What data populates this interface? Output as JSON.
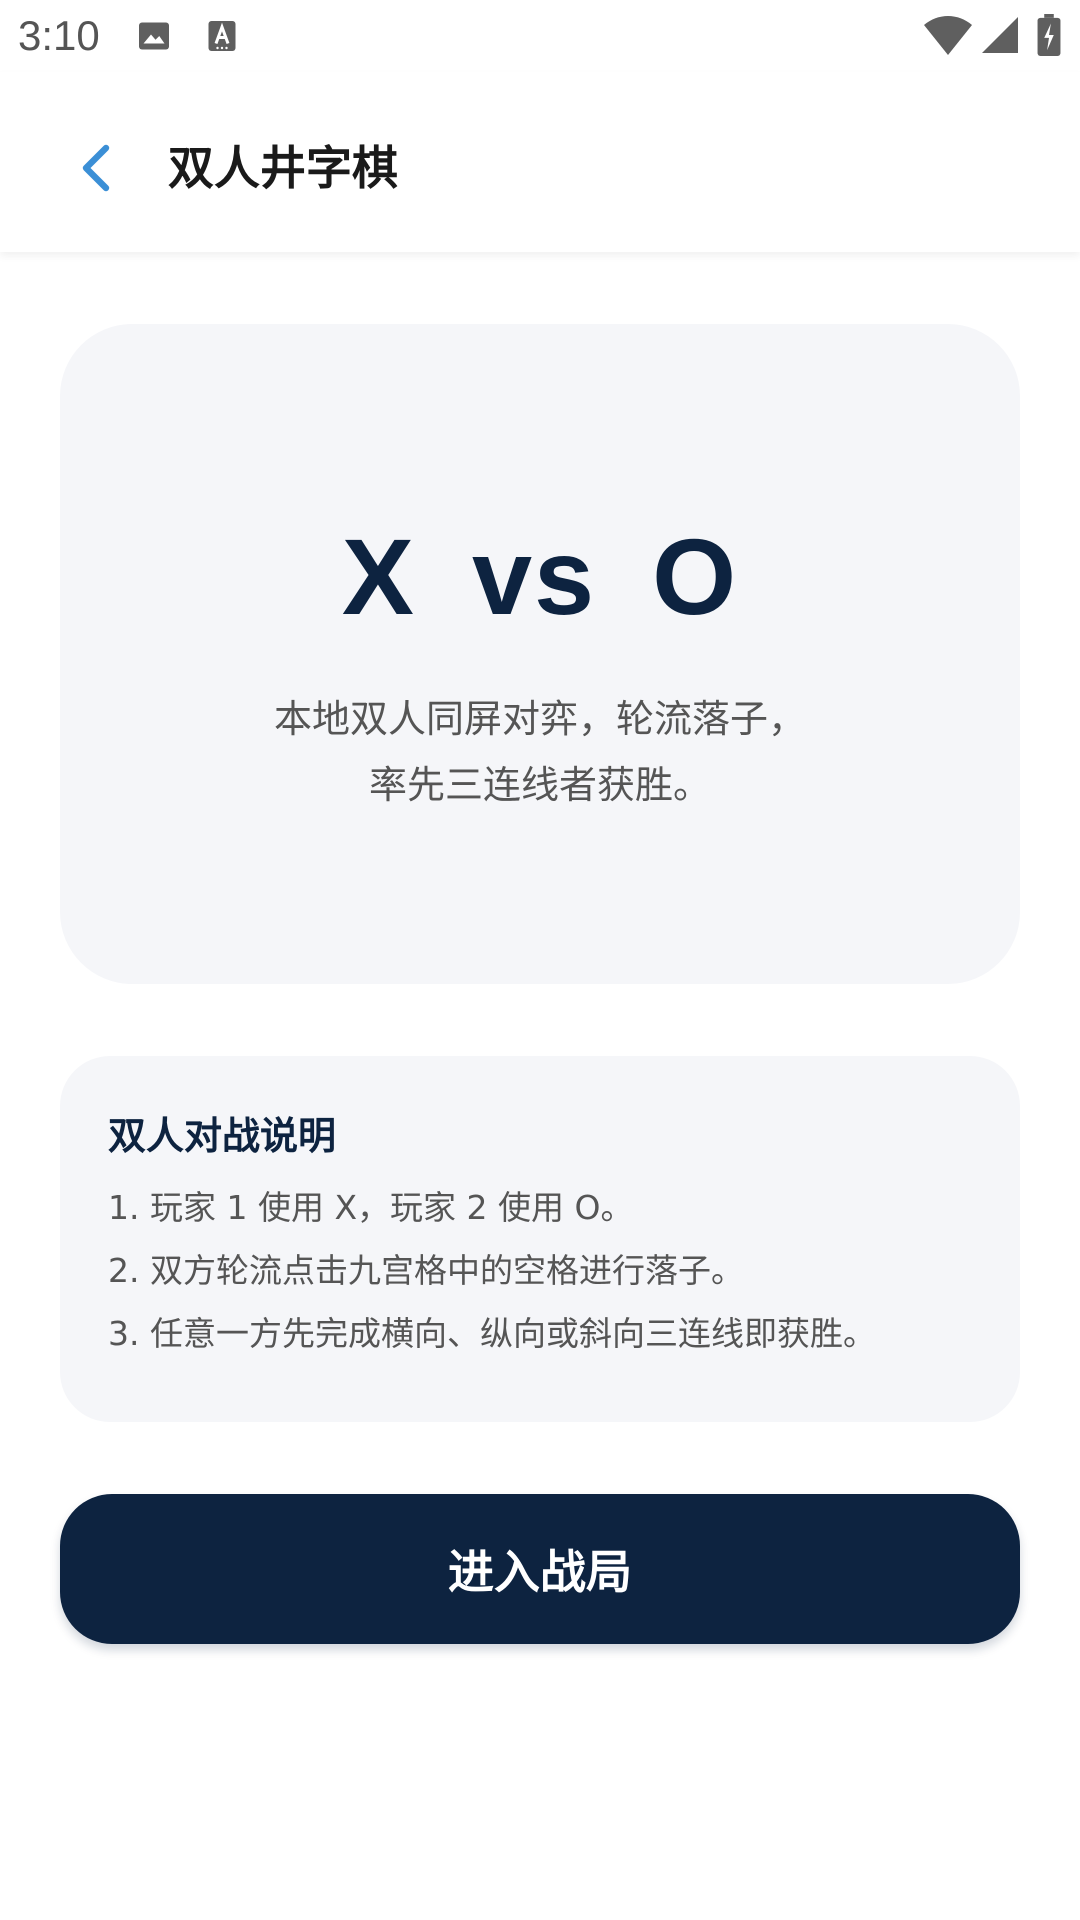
{
  "status_bar": {
    "time": "3:10",
    "left_icons": [
      "image-icon",
      "text-a-icon"
    ],
    "right_icons": [
      "wifi-icon",
      "signal-icon",
      "battery-icon"
    ]
  },
  "app_bar": {
    "back_icon": "chevron-left-icon",
    "title": "双人井字棋"
  },
  "hero": {
    "x_mark": "X",
    "vs": "vs",
    "o_mark": "O",
    "description_line1": "本地双人同屏对弈，轮流落子，",
    "description_line2": "率先三连线者获胜。"
  },
  "rules": {
    "title": "双人对战说明",
    "items": [
      "1. 玩家 1 使用 X，玩家 2 使用 O。",
      "2. 双方轮流点击九宫格中的空格进行落子。",
      "3. 任意一方先完成横向、纵向或斜向三连线即获胜。"
    ]
  },
  "action": {
    "enter_label": "进入战局"
  },
  "colors": {
    "primary": "#0d2340",
    "card_bg": "#f5f6f9",
    "accent_back": "#3b8fd6",
    "body_text": "#555555"
  }
}
